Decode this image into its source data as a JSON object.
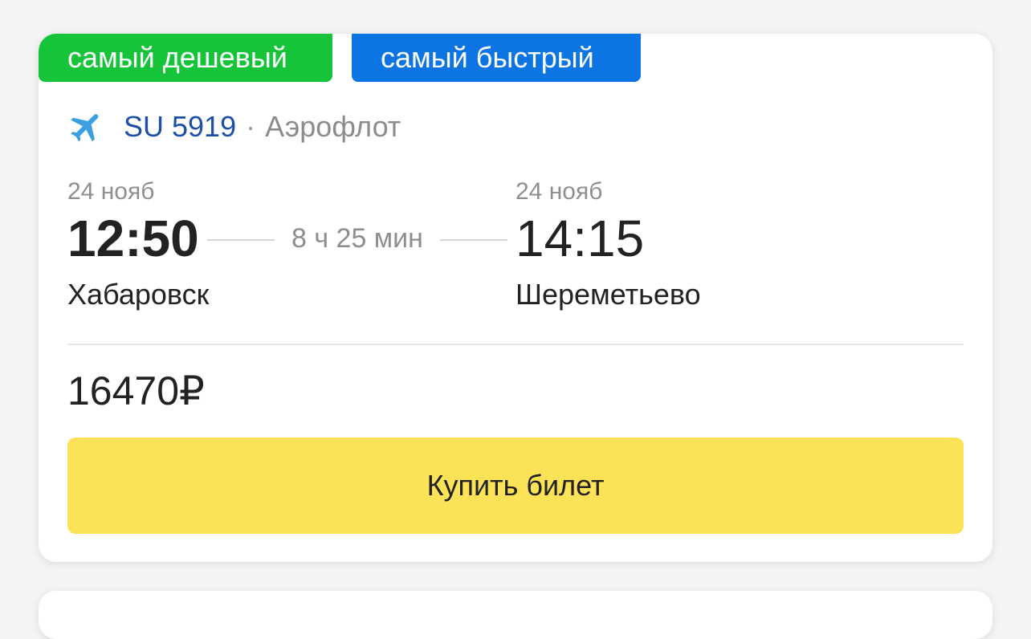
{
  "badges": {
    "cheapest": "самый дешевый",
    "fastest": "самый быстрый"
  },
  "flight": {
    "icon": "airplane-icon",
    "number": "SU 5919",
    "separator": "·",
    "airline": "Аэрофлот"
  },
  "departure": {
    "date": "24 нояб",
    "time": "12:50",
    "city": "Хабаровск"
  },
  "arrival": {
    "date": "24 нояб",
    "time": "14:15",
    "city": "Шереметьево"
  },
  "duration": "8 ч 25 мин",
  "price": "16470₽",
  "buy_button": {
    "label": "Купить билет"
  },
  "colors": {
    "cheapest_badge": "#16c43a",
    "fastest_badge": "#0d74e4",
    "flight_number": "#1e4fa8",
    "plane_icon": "#3aa0e0",
    "buy_button": "#fce257"
  }
}
